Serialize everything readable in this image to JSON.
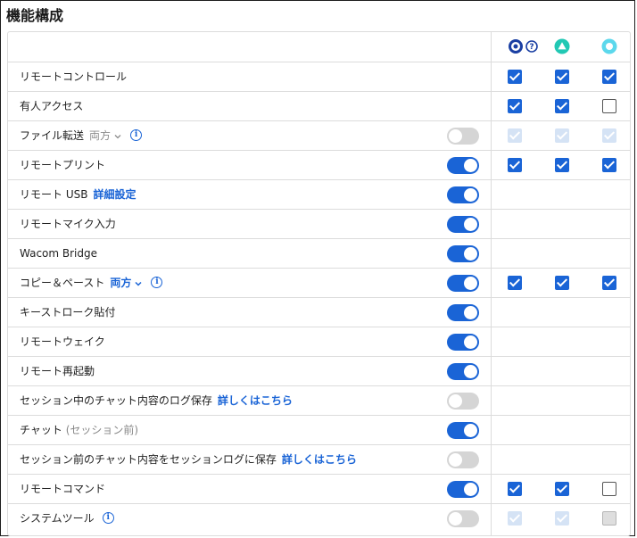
{
  "title": "機能構成",
  "colors": {
    "accent": "#1a64d6",
    "toggle_off": "#d5d5d5",
    "header_icon_1": "#1a3fa3",
    "header_icon_2": "#22c8b4",
    "header_icon_3": "#5cd8ec"
  },
  "header": {
    "icons": [
      "target-icon",
      "help-icon",
      "triangle-icon",
      "circle-dot-icon"
    ],
    "help_glyph": "?"
  },
  "rows": [
    {
      "label": "リモートコントロール",
      "toggle": null,
      "cb": [
        "checked",
        "checked",
        "checked"
      ]
    },
    {
      "label": "有人アクセス",
      "toggle": null,
      "cb": [
        "checked",
        "checked",
        "unchecked"
      ]
    },
    {
      "label": "ファイル転送",
      "dropdown": "両方",
      "info": true,
      "toggle": "off",
      "cb": [
        "disabled-checked",
        "disabled-checked",
        "disabled-checked"
      ]
    },
    {
      "label": "リモートプリント",
      "toggle": "on",
      "cb": [
        "checked",
        "checked",
        "checked"
      ]
    },
    {
      "label": "リモート USB",
      "link": "詳細設定",
      "toggle": "on",
      "cb": []
    },
    {
      "label": "リモートマイク入力",
      "toggle": "on",
      "cb": []
    },
    {
      "label": "Wacom Bridge",
      "toggle": "on",
      "cb": []
    },
    {
      "label": "コピー＆ペースト",
      "dropdown_active": "両方",
      "info": true,
      "toggle": "on",
      "cb": [
        "checked",
        "checked",
        "checked"
      ]
    },
    {
      "label": "キーストローク貼付",
      "toggle": "on",
      "cb": []
    },
    {
      "label": "リモートウェイク",
      "toggle": "on",
      "cb": []
    },
    {
      "label": "リモート再起動",
      "toggle": "on",
      "cb": []
    },
    {
      "label": "セッション中のチャット内容のログ保存",
      "link": "詳しくはこちら",
      "toggle": "off",
      "cb": []
    },
    {
      "label": "チャット",
      "muted": "(セッション前)",
      "toggle": "on",
      "cb": []
    },
    {
      "label": "セッション前のチャット内容をセッションログに保存",
      "link": "詳しくはこちら",
      "toggle": "off",
      "cb": []
    },
    {
      "label": "リモートコマンド",
      "toggle": "on",
      "cb": [
        "checked",
        "checked",
        "unchecked"
      ]
    },
    {
      "label": "システムツール",
      "info": true,
      "toggle": "off",
      "cb": [
        "disabled-checked",
        "disabled-checked",
        "disabled"
      ]
    }
  ]
}
